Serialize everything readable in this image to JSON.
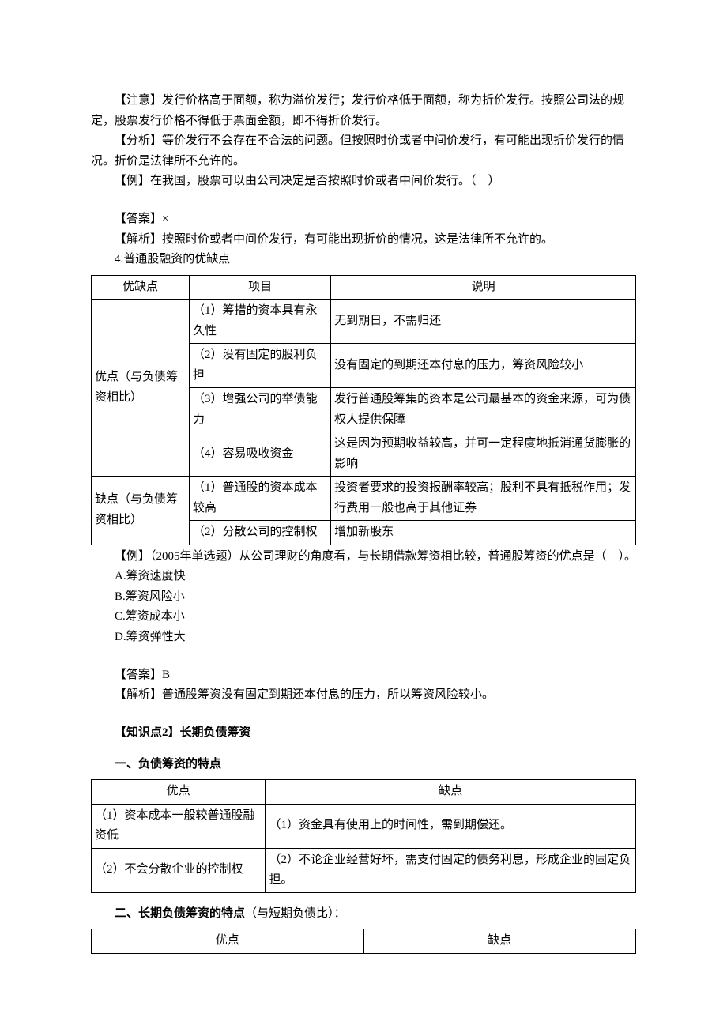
{
  "paras": {
    "p1": "【注意】发行价格高于面额，称为溢价发行；发行价格低于面额，称为折价发行。按照公司法的规定，股票发行价格不得低于票面金额，即不得折价发行。",
    "p2": "【分析】等价发行不会存在不合法的问题。但按照时价或者中间价发行，有可能出现折价发行的情况。折价是法律所不允许的。",
    "p3": "【例】在我国，股票可以由公司决定是否按照时价或者中间价发行。（　）",
    "p4": "【答案】×",
    "p5": "【解析】按照时价或者中间价发行，有可能出现折价的情况，这是法律所不允许的。",
    "p6": "4.普通股融资的优缺点"
  },
  "table1": {
    "h1": "优缺点",
    "h2": "项目",
    "h3": "说明",
    "r1c1": "优点（与负债筹资相比）",
    "r1c2": "（1）筹措的资本具有永久性",
    "r1c3": "无到期日，不需归还",
    "r2c2": "（2）没有固定的股利负担",
    "r2c3": "没有固定的到期还本付息的压力，筹资风险较小",
    "r3c2": "（3）增强公司的举债能力",
    "r3c3": "发行普通股筹集的资本是公司最基本的资金来源，可为债权人提供保障",
    "r4c2": "（4）容易吸收资金",
    "r4c3": "这是因为预期收益较高，并可一定程度地抵消通货膨胀的影响",
    "r5c1": "缺点（与负债筹资相比）",
    "r5c2": "（1）普通股的资本成本较高",
    "r5c3": "投资者要求的投资报酬率较高；股利不具有抵税作用；发行费用一般也高于其他证券",
    "r6c2": "（2）分散公司的控制权",
    "r6c3": "增加新股东"
  },
  "q2": {
    "stem": "【例】（2005年单选题）从公司理财的角度看，与长期借款筹资相比较，普通股筹资的优点是（　）。",
    "a": "A.筹资速度快",
    "b": "B.筹资风险小",
    "c": "C.筹资成本小",
    "d": "D.筹资弹性大",
    "ans": "【答案】B",
    "exp": "【解析】普通股筹资没有固定到期还本付息的压力，所以筹资风险较小。"
  },
  "kp2_title": "【知识点2】长期负债筹资",
  "sec1_title": "一、负债筹资的特点",
  "table2": {
    "h1": "优点",
    "h2": "缺点",
    "r1c1": "（1）资本成本一般较普通股融资低",
    "r1c2": "（1）资金具有使用上的时间性，需到期偿还。",
    "r2c1": "（2）不会分散企业的控制权",
    "r2c2": "（2）不论企业经营好坏，需支付固定的债务利息，形成企业的固定负担。"
  },
  "sec2_title_bold": "二、长期负债筹资的特点",
  "sec2_title_rest": "（与短期负债比）：",
  "table3": {
    "h1": "优点",
    "h2": "缺点"
  }
}
